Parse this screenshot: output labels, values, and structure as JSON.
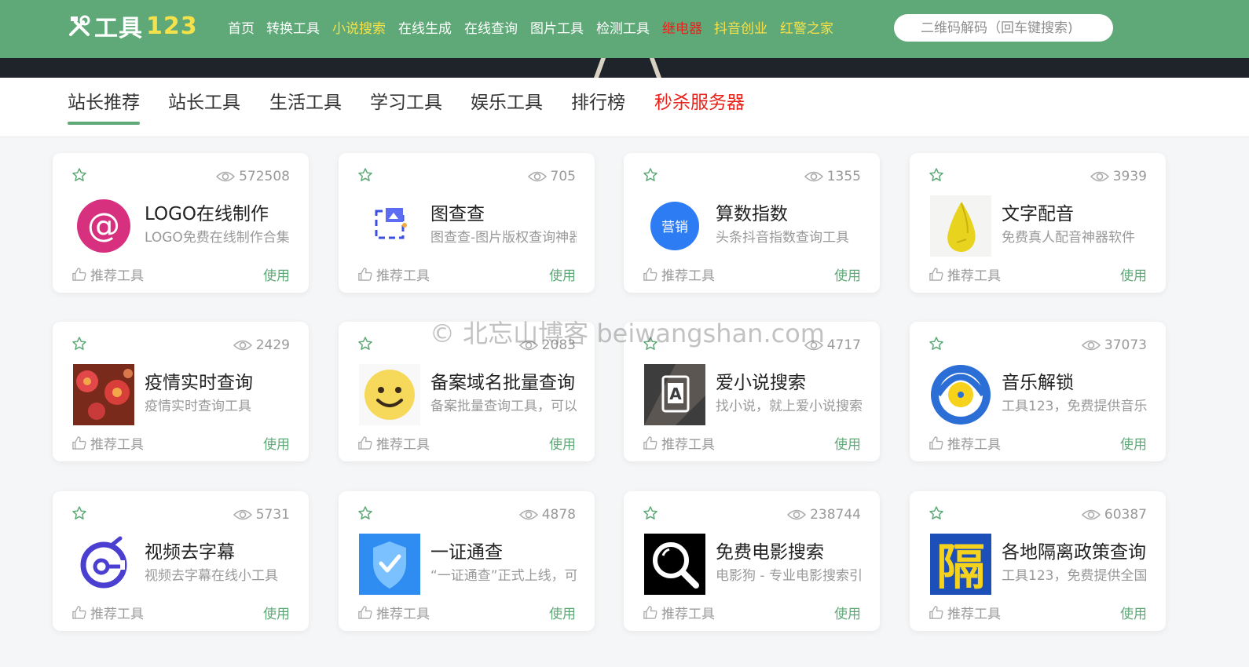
{
  "header": {
    "logo_text": "工具",
    "logo_num": "123",
    "nav": [
      {
        "label": "首页",
        "color": "#ffffff"
      },
      {
        "label": "转换工具",
        "color": "#ffffff"
      },
      {
        "label": "小说搜索",
        "color": "#f5e24b"
      },
      {
        "label": "在线生成",
        "color": "#ffffff"
      },
      {
        "label": "在线查询",
        "color": "#ffffff"
      },
      {
        "label": "图片工具",
        "color": "#ffffff"
      },
      {
        "label": "检测工具",
        "color": "#ffffff"
      },
      {
        "label": "继电器",
        "color": "#e8231b"
      },
      {
        "label": "抖音创业",
        "color": "#f5e24b"
      },
      {
        "label": "红警之家",
        "color": "#f5e24b"
      }
    ],
    "search_placeholder": "二维码解码（回车键搜索)"
  },
  "tabs": [
    {
      "label": "站长推荐",
      "active": true,
      "color": "#333333"
    },
    {
      "label": "站长工具",
      "active": false,
      "color": "#333333"
    },
    {
      "label": "生活工具",
      "active": false,
      "color": "#333333"
    },
    {
      "label": "学习工具",
      "active": false,
      "color": "#333333"
    },
    {
      "label": "娱乐工具",
      "active": false,
      "color": "#333333"
    },
    {
      "label": "排行榜",
      "active": false,
      "color": "#333333"
    },
    {
      "label": "秒杀服务器",
      "active": false,
      "color": "#e8231b"
    }
  ],
  "cards": [
    {
      "title": "LOGO在线制作",
      "desc": "LOGO免费在线制作合集",
      "views": "572508",
      "icon": "at-sign-icon"
    },
    {
      "title": "图查查",
      "desc": "图查查-图片版权查询神器",
      "views": "705",
      "icon": "image-search-icon"
    },
    {
      "title": "算数指数",
      "desc": "头条抖音指数查询工具",
      "views": "1355",
      "icon": "marketing-badge-icon",
      "icon_text": "营销"
    },
    {
      "title": "文字配音",
      "desc": "免费真人配音神器软件",
      "views": "3939",
      "icon": "pear-icon"
    },
    {
      "title": "疫情实时查询",
      "desc": "疫情实时查询工具",
      "views": "2429",
      "icon": "virus-icon"
    },
    {
      "title": "备案域名批量查询",
      "desc": "备案批量查询工具，可以",
      "views": "2083",
      "icon": "smiley-icon"
    },
    {
      "title": "爱小说搜索",
      "desc": "找小说，就上爱小说搜索",
      "views": "4717",
      "icon": "book-icon"
    },
    {
      "title": "音乐解锁",
      "desc": "工具123，免费提供音乐",
      "views": "37073",
      "icon": "music-disc-icon"
    },
    {
      "title": "视频去字幕",
      "desc": "视频去字幕在线小工具",
      "views": "5731",
      "icon": "subtitle-remove-icon"
    },
    {
      "title": "一证通查",
      "desc": "“一证通查”正式上线，可",
      "views": "4878",
      "icon": "shield-check-icon"
    },
    {
      "title": "免费电影搜索",
      "desc": "电影狗 - 专业电影搜索引",
      "views": "238744",
      "icon": "magnifier-icon"
    },
    {
      "title": "各地隔离政策查询",
      "desc": "工具123，免费提供全国",
      "views": "60387",
      "icon": "isolation-glyph-icon",
      "icon_text": "隔"
    }
  ],
  "card_labels": {
    "recommend": "推荐工具",
    "use": "使用"
  },
  "watermark": "© 北忘山博客 beiwangshan.com",
  "colors": {
    "accent": "#5fa878",
    "header_bg": "#5fa878",
    "highlight_yellow": "#f5e24b",
    "highlight_red": "#e8231b"
  }
}
